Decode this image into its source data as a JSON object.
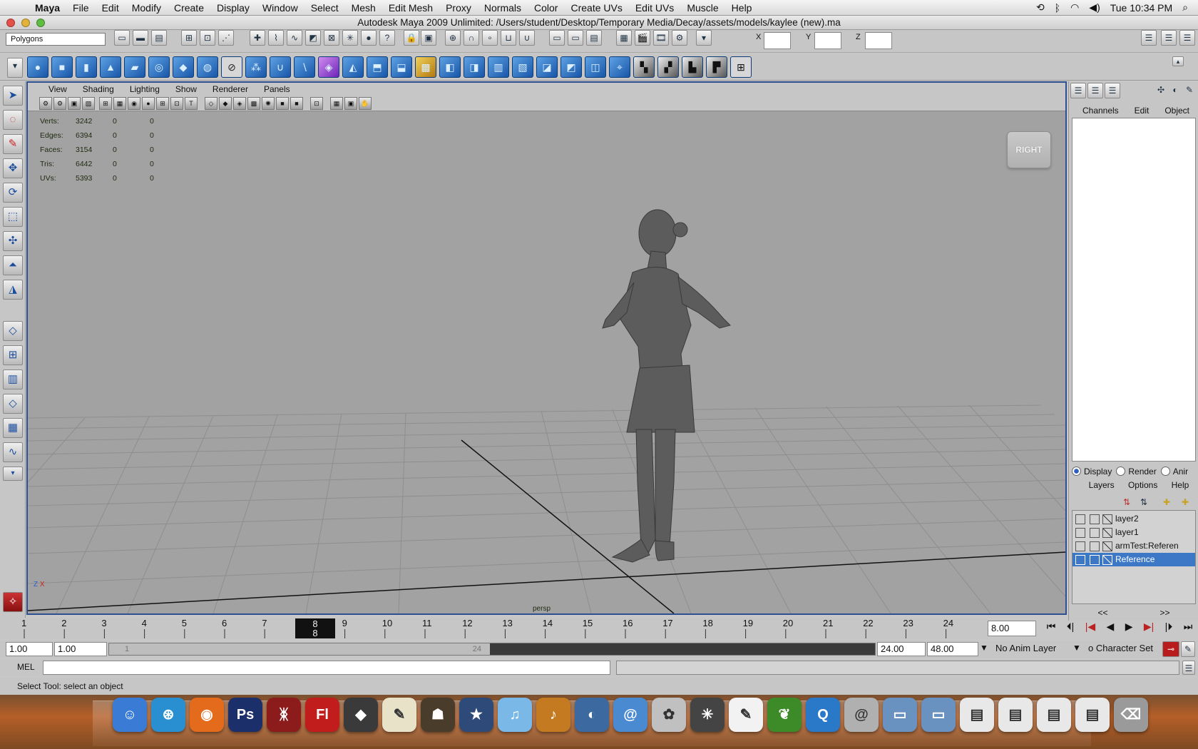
{
  "menubar": {
    "app_name": "Maya",
    "items": [
      "File",
      "Edit",
      "Modify",
      "Create",
      "Display",
      "Window",
      "Select",
      "Mesh",
      "Edit Mesh",
      "Proxy",
      "Normals",
      "Color",
      "Create UVs",
      "Edit UVs",
      "Muscle",
      "Help"
    ],
    "clock": "Tue 10:34 PM"
  },
  "window": {
    "title": "Autodesk Maya 2009 Unlimited: /Users/student/Desktop/Temporary Media/Decay/assets/models/kaylee (new).ma"
  },
  "statusline": {
    "mode": "Polygons",
    "x_label": "X",
    "y_label": "Y",
    "z_label": "Z"
  },
  "panel": {
    "menu": [
      "View",
      "Shading",
      "Lighting",
      "Show",
      "Renderer",
      "Panels"
    ],
    "hud": [
      {
        "label": "Verts:",
        "v1": "3242",
        "v2": "0",
        "v3": "0"
      },
      {
        "label": "Edges:",
        "v1": "6394",
        "v2": "0",
        "v3": "0"
      },
      {
        "label": "Faces:",
        "v1": "3154",
        "v2": "0",
        "v3": "0"
      },
      {
        "label": "Tris:",
        "v1": "6442",
        "v2": "0",
        "v3": "0"
      },
      {
        "label": "UVs:",
        "v1": "5393",
        "v2": "0",
        "v3": "0"
      }
    ],
    "viewcube": "RIGHT",
    "camera": "persp",
    "axis_z": "Z",
    "axis_x": "X"
  },
  "channel_box": {
    "tabs": [
      "Channels",
      "Edit",
      "Object"
    ]
  },
  "layer_editor": {
    "display_opts": [
      "Display",
      "Render",
      "Anir"
    ],
    "menu": [
      "Layers",
      "Options",
      "Help"
    ],
    "layers": [
      {
        "name": "layer2",
        "selected": false
      },
      {
        "name": "layer1",
        "selected": false
      },
      {
        "name": "armTest:Referen",
        "selected": false
      },
      {
        "name": "Reference",
        "selected": true
      }
    ],
    "prev": "<<",
    "next": ">>"
  },
  "timeline": {
    "ticks": [
      "1",
      "2",
      "3",
      "4",
      "5",
      "6",
      "7",
      "8",
      "9",
      "10",
      "11",
      "12",
      "13",
      "14",
      "15",
      "16",
      "17",
      "18",
      "19",
      "20",
      "21",
      "22",
      "23",
      "24"
    ],
    "current_frame": "8",
    "current_time": "8.00"
  },
  "range": {
    "start_anim": "1.00",
    "start_play": "1.00",
    "thumb_start": "1",
    "thumb_end": "24",
    "end_play": "24.00",
    "end_anim": "48.00",
    "anim_layer": "No Anim Layer",
    "char_set": "o Character Set"
  },
  "command": {
    "lang": "MEL"
  },
  "help_line": "Select Tool: select an object",
  "dock": [
    "Finder",
    "Safari",
    "Firefox",
    "Ps",
    "Maya",
    "Fl",
    "Unity",
    "Scriptorium",
    "Warcraft",
    "iMovie",
    "iTunes",
    "GarageBand",
    "Preview",
    "Mail",
    "Photos",
    "Pinwheel",
    "TextEdit",
    "Plant",
    "QuickTime",
    "Mail Stamp",
    "Folder",
    "Folder",
    "Thumbs",
    "Thumbs",
    "Thumbs",
    "Thumbs",
    "Trash"
  ],
  "colors": {
    "viewport": "#a2a2a2",
    "panel_border": "#2f4f93",
    "selection": "#3d78c6"
  }
}
